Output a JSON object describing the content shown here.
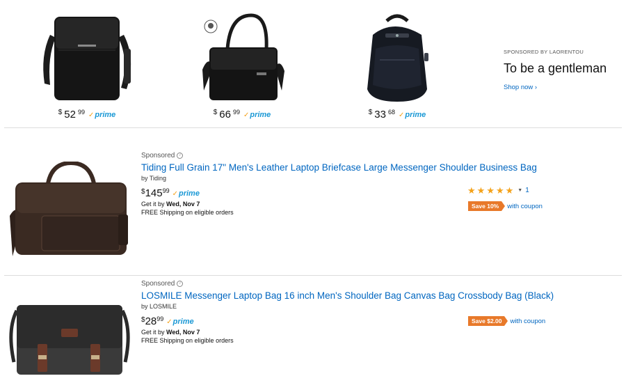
{
  "brand_strip": {
    "products": [
      {
        "name": "Black leather messenger bag",
        "dollar": "$",
        "whole": "52",
        "fraction": "99",
        "prime": "prime"
      },
      {
        "name": "Black leather briefcase",
        "dollar": "$",
        "whole": "66",
        "fraction": "99",
        "prime": "prime"
      },
      {
        "name": "Black backpack",
        "dollar": "$",
        "whole": "33",
        "fraction": "68",
        "prime": "prime"
      }
    ],
    "sponsor_label": "SPONSORED BY LAORENTOU",
    "headline": "To be a gentleman",
    "cta": "Shop now ›"
  },
  "results": [
    {
      "sponsored": "Sponsored",
      "title": "Tiding Full Grain 17\" Men's Leather Laptop Briefcase Large Messenger Shoulder Business Bag",
      "by": "by Tiding",
      "price": {
        "dollar": "$",
        "whole": "145",
        "fraction": "99"
      },
      "prime": "prime",
      "delivery_prefix": "Get it by",
      "delivery_date": "Wed, Nov 7",
      "shipping": "FREE Shipping on eligible orders",
      "rating": {
        "stars": 5,
        "count": "1"
      },
      "coupon": {
        "badge": "Save 10%",
        "text": "with coupon"
      }
    },
    {
      "sponsored": "Sponsored",
      "title": "LOSMILE Messenger Laptop Bag 16 inch Men's Shoulder Bag Canvas Bag Crossbody Bag (Black)",
      "by": "by LOSMILE",
      "price": {
        "dollar": "$",
        "whole": "28",
        "fraction": "99"
      },
      "prime": "prime",
      "delivery_prefix": "Get it by",
      "delivery_date": "Wed, Nov 7",
      "shipping": "FREE Shipping on eligible orders",
      "coupon": {
        "badge": "Save $2.00",
        "text": "with coupon"
      }
    }
  ],
  "colors": {
    "link": "#0066c0",
    "prime": "#1a98d5",
    "star": "#f4a21a",
    "coupon": "#e8792a"
  }
}
